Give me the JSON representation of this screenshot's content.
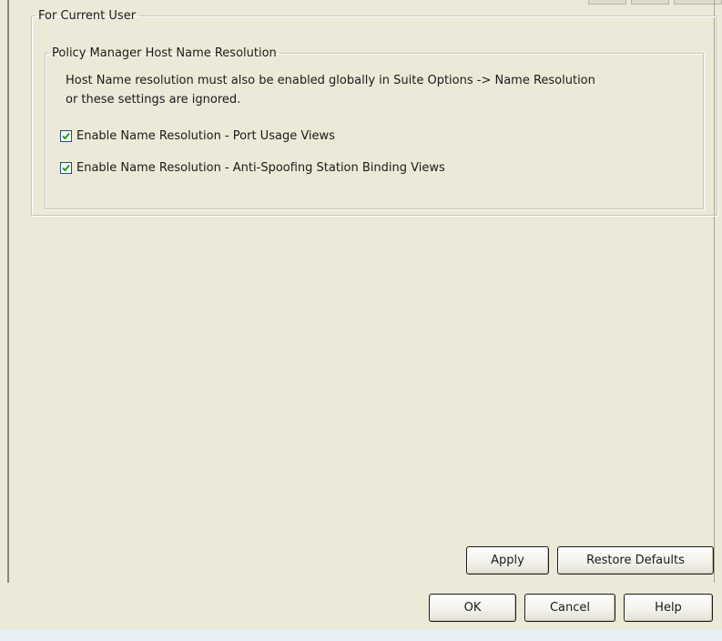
{
  "outer_group": {
    "legend": "For Current User"
  },
  "policy_group": {
    "legend": "Policy Manager Host Name Resolution",
    "info_line_1": "Host Name resolution must also be enabled globally in Suite Options -> Name Resolution",
    "info_line_2": "or these settings are ignored."
  },
  "options": [
    {
      "label": "Enable Name Resolution - Port Usage Views",
      "checked": true
    },
    {
      "label": "Enable Name Resolution - Anti-Spoofing Station Binding Views",
      "checked": true
    }
  ],
  "panel_buttons": {
    "apply_label": "Apply",
    "restore_defaults_label": "Restore Defaults"
  },
  "dialog_buttons": {
    "ok_label": "OK",
    "cancel_label": "Cancel",
    "help_label": "Help"
  },
  "colors": {
    "background": "#ece9d8",
    "checkmark": "#21a121",
    "checkbox_border": "#1c5180"
  },
  "icons": {
    "checkbox_checked": "check-icon"
  }
}
